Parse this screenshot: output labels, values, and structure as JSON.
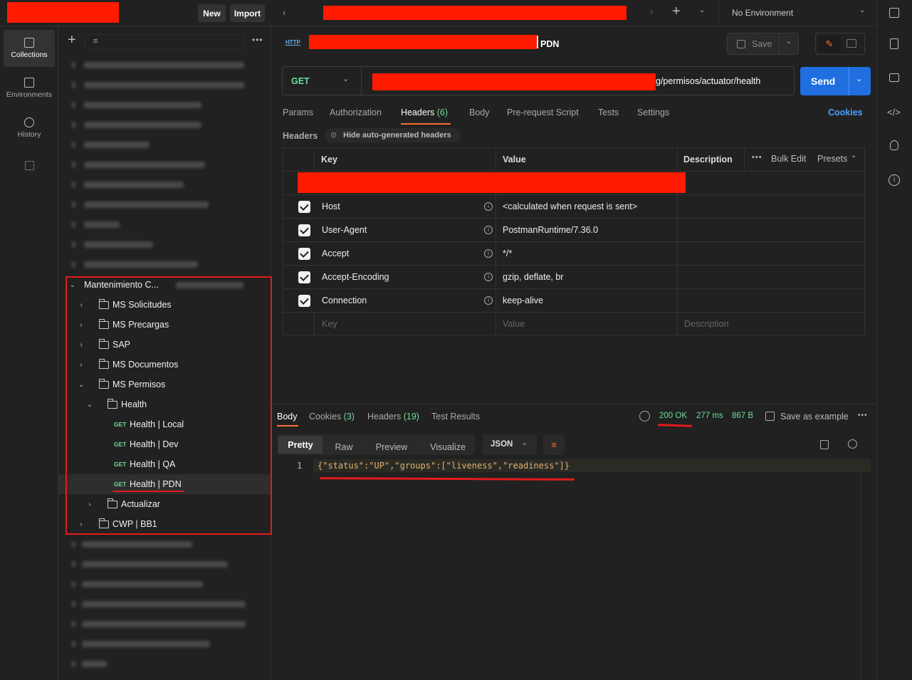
{
  "topbar": {
    "new_label": "New",
    "import_label": "Import",
    "environment": "No Environment"
  },
  "rail": {
    "collections": "Collections",
    "environments": "Environments",
    "history": "History"
  },
  "sidebar": {
    "collection_name": "Mantenimiento C...",
    "items": [
      {
        "label": "MS Solicitudes",
        "type": "folder"
      },
      {
        "label": "MS Precargas",
        "type": "folder"
      },
      {
        "label": "SAP",
        "type": "folder"
      },
      {
        "label": "MS Documentos",
        "type": "folder"
      },
      {
        "label": "MS Permisos",
        "type": "folder"
      },
      {
        "label": "Health",
        "type": "folder"
      },
      {
        "label": "Health | Local",
        "type": "request",
        "method": "GET"
      },
      {
        "label": "Health | Dev",
        "type": "request",
        "method": "GET"
      },
      {
        "label": "Health | QA",
        "type": "request",
        "method": "GET"
      },
      {
        "label": "Health | PDN",
        "type": "request",
        "method": "GET"
      },
      {
        "label": "Actualizar",
        "type": "folder"
      },
      {
        "label": "CWP | BB1",
        "type": "folder"
      }
    ]
  },
  "request": {
    "name": "PDN",
    "save_label": "Save",
    "method": "GET",
    "url_suffix": "g/permisos/actuator/health",
    "send_label": "Send",
    "tabs": [
      "Params",
      "Authorization",
      "Headers",
      "Body",
      "Pre-request Script",
      "Tests",
      "Settings"
    ],
    "headers_count": "(6)",
    "cookies_label": "Cookies",
    "headers_title": "Headers",
    "hide_auto": "Hide auto-generated headers",
    "columns": {
      "key": "Key",
      "value": "Value",
      "description": "Description",
      "bulk_edit": "Bulk Edit",
      "presets": "Presets"
    },
    "rows": [
      {
        "key": "Host",
        "value": "<calculated when request is sent>"
      },
      {
        "key": "User-Agent",
        "value": "PostmanRuntime/7.36.0"
      },
      {
        "key": "Accept",
        "value": "*/*"
      },
      {
        "key": "Accept-Encoding",
        "value": "gzip, deflate, br"
      },
      {
        "key": "Connection",
        "value": "keep-alive"
      }
    ],
    "placeholders": {
      "key": "Key",
      "value": "Value",
      "description": "Description"
    }
  },
  "response": {
    "tabs": {
      "body": "Body",
      "cookies": "Cookies",
      "cookies_count": "(3)",
      "headers": "Headers",
      "headers_count": "(19)",
      "tests": "Test Results"
    },
    "status": "200 OK",
    "time": "277 ms",
    "size": "867 B",
    "save_example": "Save as example",
    "view_tabs": [
      "Pretty",
      "Raw",
      "Preview",
      "Visualize"
    ],
    "format": "JSON",
    "line_number": "1",
    "body_text": "{\"status\":\"UP\",\"groups\":[\"liveness\",\"readiness\"]}"
  },
  "colors": {
    "accent": "#ff6c37",
    "send": "#1f6fe0",
    "success": "#6bdd9a",
    "highlight": "#e31b1b"
  }
}
